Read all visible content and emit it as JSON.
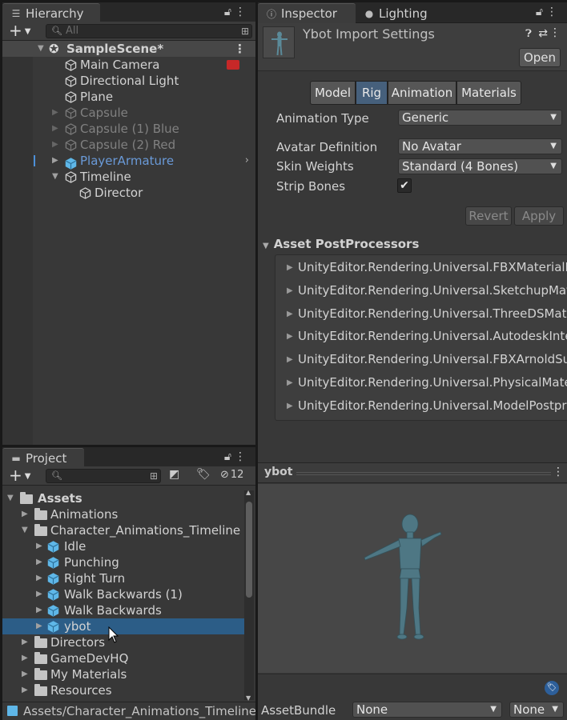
{
  "hierarchy": {
    "tab_label": "Hierarchy",
    "search_placeholder": "All",
    "scene": "SampleScene*",
    "items": [
      {
        "label": "Main Camera",
        "state": "normal"
      },
      {
        "label": "Directional Light",
        "state": "normal"
      },
      {
        "label": "Plane",
        "state": "normal"
      },
      {
        "label": "Capsule",
        "state": "disabled"
      },
      {
        "label": "Capsule (1) Blue",
        "state": "disabled"
      },
      {
        "label": "Capsule (2) Red",
        "state": "disabled"
      },
      {
        "label": "PlayerArmature",
        "state": "prefab"
      },
      {
        "label": "Timeline",
        "state": "normal"
      },
      {
        "label": "Director",
        "state": "normal"
      }
    ]
  },
  "project": {
    "tab_label": "Project",
    "hidden_count": "12",
    "root": "Assets",
    "items": [
      {
        "label": "Animations",
        "type": "folder"
      },
      {
        "label": "Character_Animations_Timeline",
        "type": "folder-open"
      },
      {
        "label": "Idle",
        "type": "model"
      },
      {
        "label": "Punching",
        "type": "model"
      },
      {
        "label": "Right Turn",
        "type": "model"
      },
      {
        "label": "Walk Backwards (1)",
        "type": "model"
      },
      {
        "label": "Walk Backwards",
        "type": "model"
      },
      {
        "label": "ybot",
        "type": "model"
      },
      {
        "label": "Directors",
        "type": "folder"
      },
      {
        "label": "GameDevHQ",
        "type": "folder"
      },
      {
        "label": "My Materials",
        "type": "folder"
      },
      {
        "label": "Resources",
        "type": "folder"
      }
    ],
    "path": "Assets/Character_Animations_Timeline/"
  },
  "inspector": {
    "tab_label": "Inspector",
    "tab2_label": "Lighting",
    "title": "Ybot Import Settings",
    "open_label": "Open",
    "tabs": [
      "Model",
      "Rig",
      "Animation",
      "Materials"
    ],
    "active_tab": "Rig",
    "fields": {
      "animation_type_label": "Animation Type",
      "animation_type_value": "Generic",
      "avatar_def_label": "Avatar Definition",
      "avatar_def_value": "No Avatar",
      "skin_weights_label": "Skin Weights",
      "skin_weights_value": "Standard (4 Bones)",
      "strip_bones_label": "Strip Bones",
      "strip_bones_checked": true
    },
    "revert_label": "Revert",
    "apply_label": "Apply",
    "postprocessors_header": "Asset PostProcessors",
    "postprocessors": [
      "UnityEditor.Rendering.Universal.FBXMaterialDe",
      "UnityEditor.Rendering.Universal.SketchupMate",
      "UnityEditor.Rendering.Universal.ThreeDSMater",
      "UnityEditor.Rendering.Universal.AutodeskIntera",
      "UnityEditor.Rendering.Universal.FBXArnoldSurf",
      "UnityEditor.Rendering.Universal.PhysicalMater",
      "UnityEditor.Rendering.Universal.ModelPostproc"
    ],
    "preview_title": "ybot",
    "assetbundle_label": "AssetBundle",
    "assetbundle_value": "None",
    "assetbundle_variant": "None"
  },
  "colors": {
    "selection": "#2c5d87",
    "active_tab": "#46607c",
    "prefab_text": "#6a9ad8",
    "model_icon": "#5fb7e8"
  }
}
